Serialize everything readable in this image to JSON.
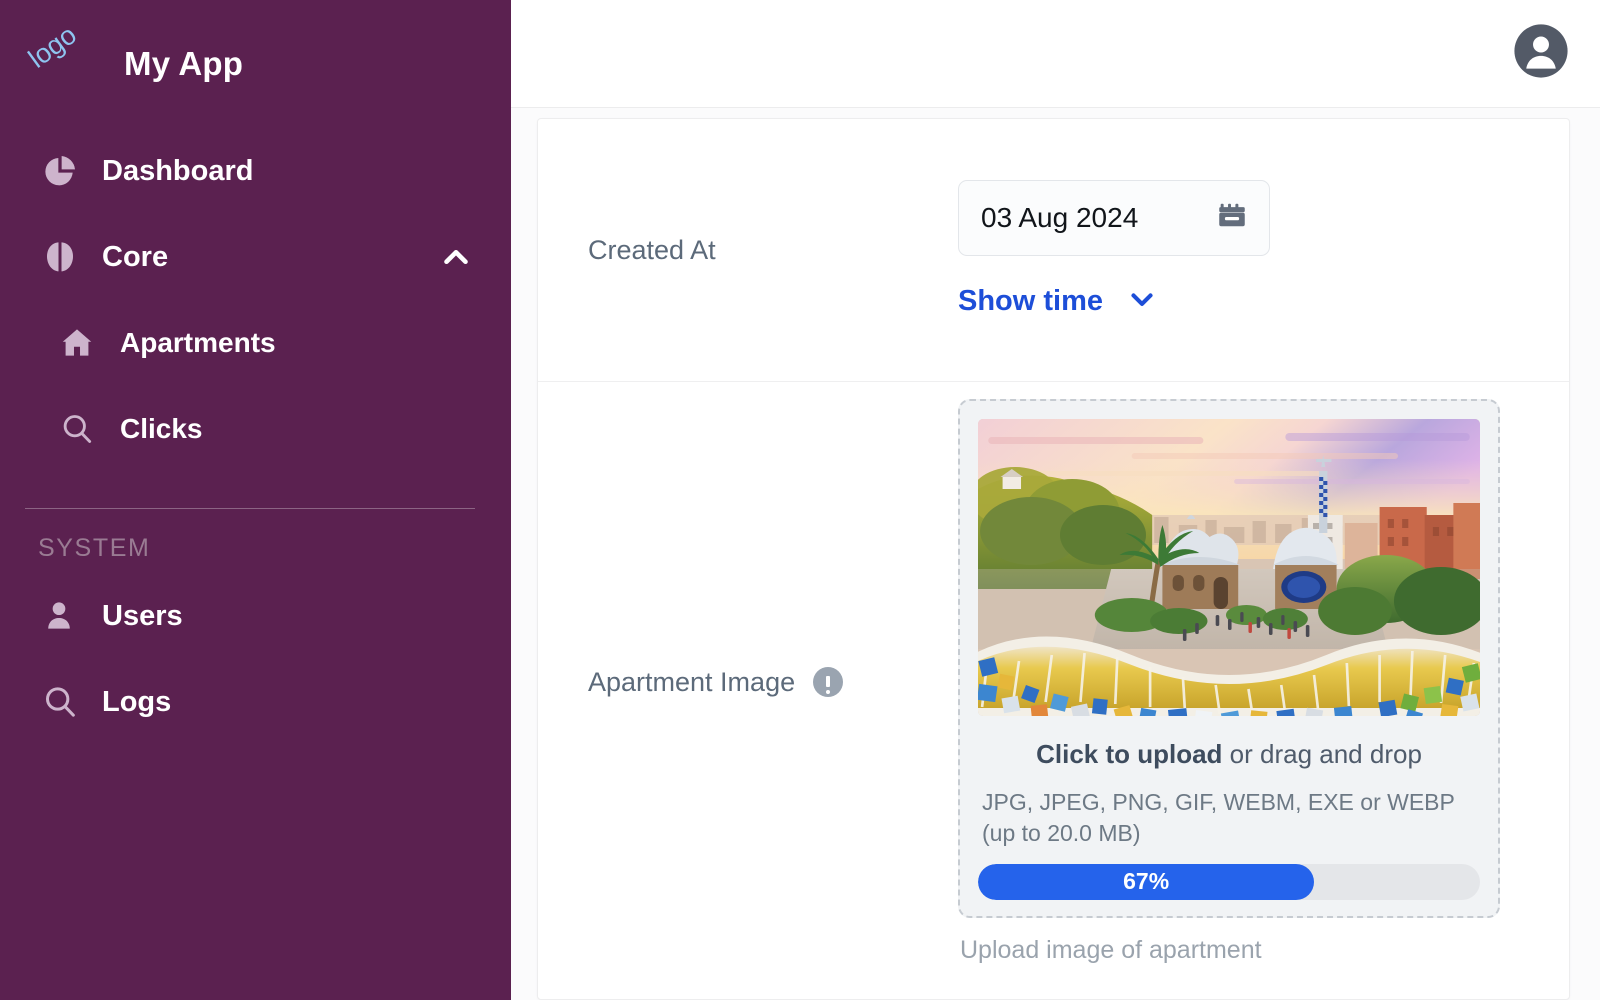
{
  "sidebar": {
    "brand": {
      "logo_text": "logo",
      "title": "My App"
    },
    "items": [
      {
        "label": "Dashboard",
        "icon": "pie-chart-icon"
      },
      {
        "label": "Core",
        "icon": "brain-icon",
        "chevron": "chevron-up-icon"
      },
      {
        "label": "Apartments",
        "icon": "home-icon"
      },
      {
        "label": "Clicks",
        "icon": "search-icon"
      }
    ],
    "section_label": "SYSTEM",
    "system_items": [
      {
        "label": "Users",
        "icon": "user-icon"
      },
      {
        "label": "Logs",
        "icon": "search-icon"
      }
    ],
    "bg_color": "#5b2150"
  },
  "topbar": {
    "avatar": "user-avatar-icon"
  },
  "form": {
    "created_at": {
      "label": "Created At",
      "date_value": "03 Aug 2024",
      "calendar_icon": "calendar-icon",
      "show_time_label": "Show time",
      "show_time_chevron": "chevron-down-icon",
      "link_color": "#1d4ed8"
    },
    "apartment_image": {
      "label": "Apartment Image",
      "info_icon": "info-exclamation-icon",
      "upload_cta_bold": "Click to upload",
      "upload_cta_rest": " or drag and drop",
      "accepted_types": "JPG, JPEG, PNG, GIF, WEBM, EXE or WEBP (up to 20.0 MB)",
      "progress_percent": "67%",
      "progress_value": 67,
      "progress_color": "#2563eb",
      "help_text": "Upload image of apartment",
      "preview_alt": "Park Guell Barcelona at sunset"
    }
  }
}
